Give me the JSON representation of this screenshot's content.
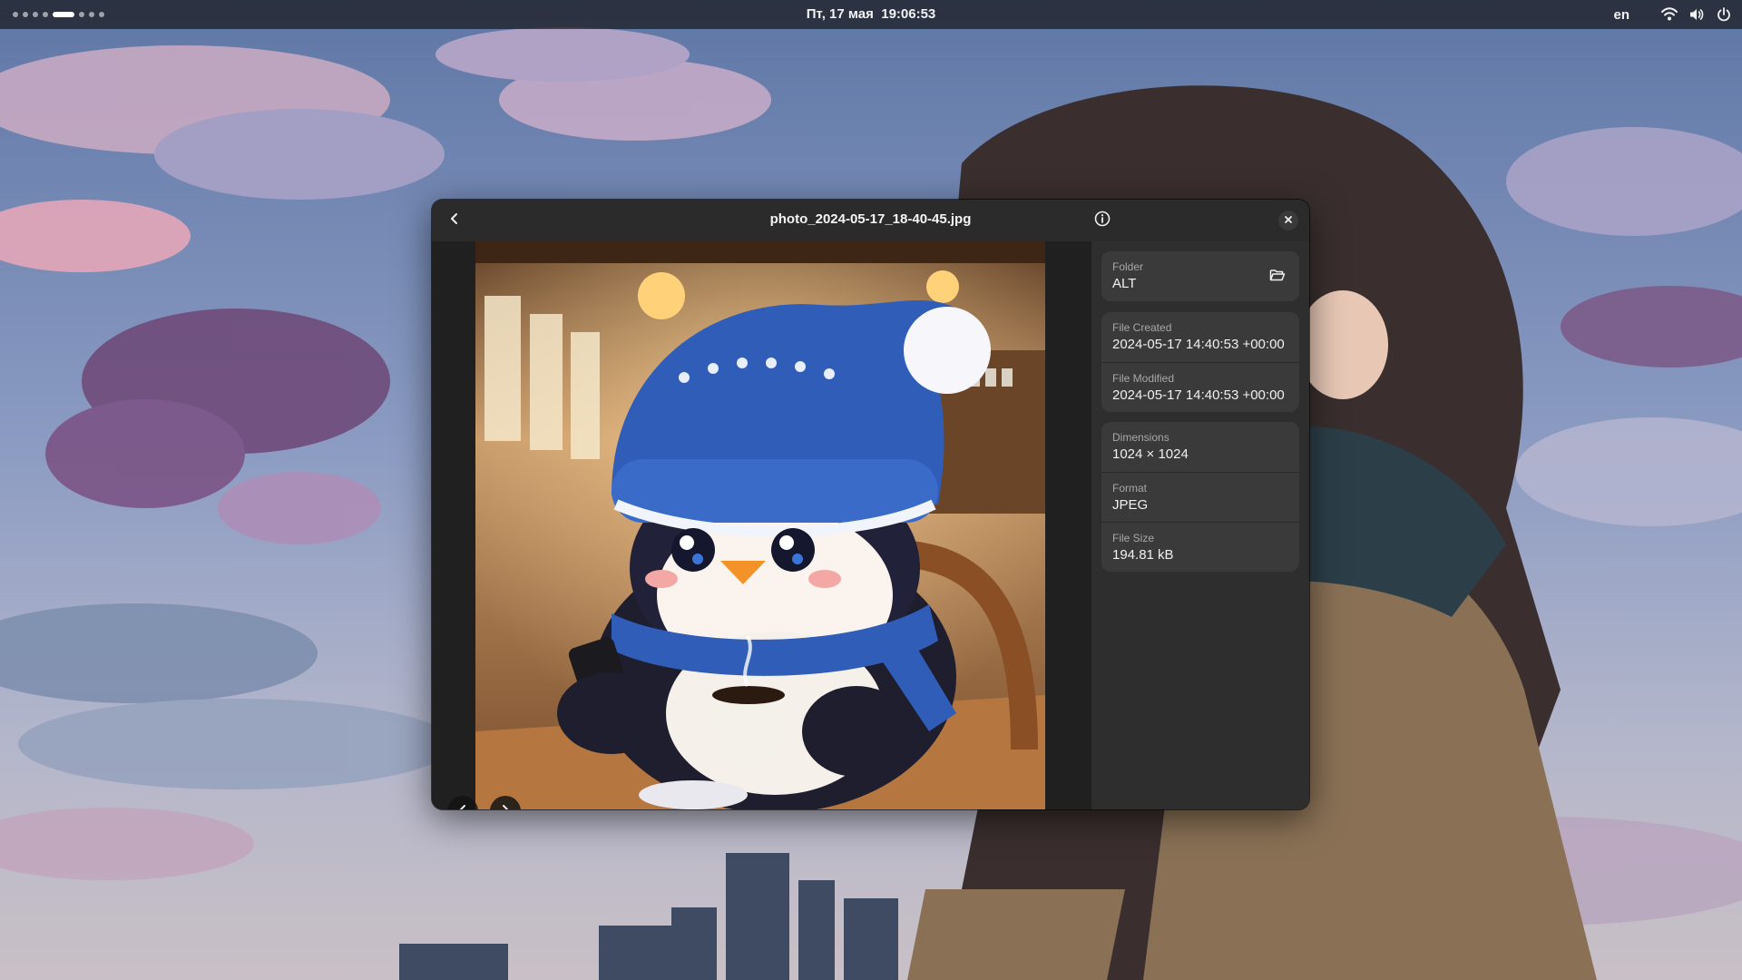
{
  "topbar": {
    "clock_date": "Пт, 17 мая",
    "clock_time": "19:06:53",
    "language": "en",
    "workspace_count": 8,
    "active_workspace": 5,
    "icons": [
      "wifi-icon",
      "volume-icon",
      "power-icon"
    ]
  },
  "window": {
    "title": "photo_2024-05-17_18-40-45.jpg",
    "icons": [
      "back-arrow-icon",
      "info-icon",
      "close-icon",
      "chevron-left-icon",
      "chevron-right-icon"
    ]
  },
  "properties": {
    "folder": {
      "label": "Folder",
      "value": "ALT",
      "icon": "folder-open-icon"
    },
    "created": {
      "label": "File Created",
      "value": "2024-05-17 14:40:53 +00:00"
    },
    "modified": {
      "label": "File Modified",
      "value": "2024-05-17 14:40:53 +00:00"
    },
    "dimensions": {
      "label": "Dimensions",
      "value": "1024 × 1024"
    },
    "format": {
      "label": "Format",
      "value": "JPEG"
    },
    "size": {
      "label": "File Size",
      "value": "194.81 kB"
    }
  },
  "colors": {
    "window_bg": "#242424",
    "sidebar_bg": "#2e2e2e",
    "card_bg": "#3a3a3a",
    "topbar_bg": "#18181c"
  }
}
